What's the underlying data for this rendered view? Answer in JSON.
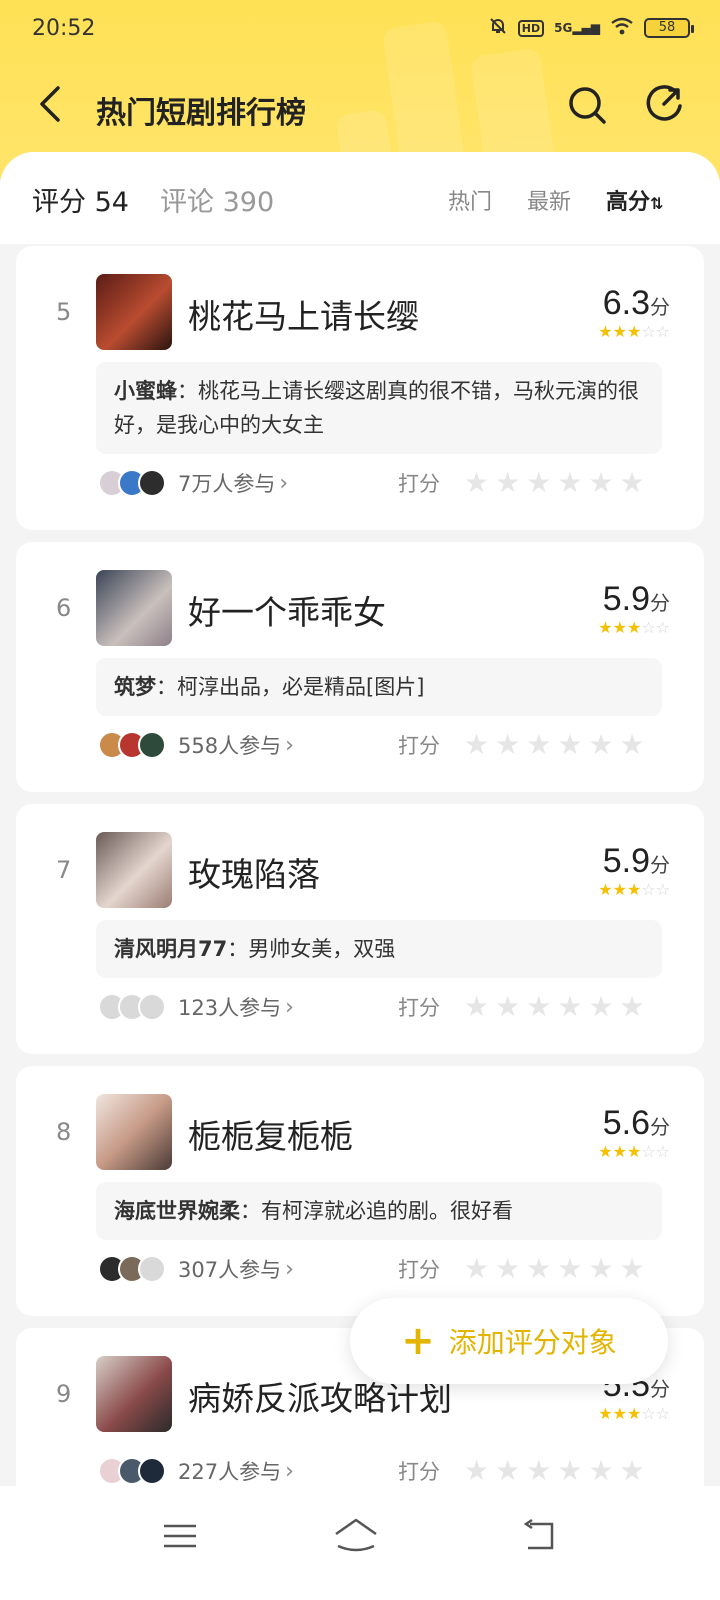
{
  "status_bar": {
    "time": "20:52",
    "battery": "58",
    "network": "5G",
    "hd": "HD"
  },
  "header": {
    "title": "热门短剧排行榜"
  },
  "summary": {
    "score_tab": "评分 54",
    "comment_tab": "评论 390"
  },
  "sort_options": [
    "热门",
    "最新",
    "高分"
  ],
  "sort_active_icon": "⇅",
  "rate_label": "打分",
  "items": [
    {
      "rank": "5",
      "title": "桃花马上请长缨",
      "score": "6.3",
      "unit": "分",
      "stars": 3,
      "user": "小蜜蜂",
      "comment": "：桃花马上请长缨这剧真的很不错，马秋元演的很好，是我心中的大女主",
      "participants": "7万人参与"
    },
    {
      "rank": "6",
      "title": "好一个乖乖女",
      "score": "5.9",
      "unit": "分",
      "stars": 3,
      "user": "筑梦",
      "comment": "：柯淳出品，必是精品[图片]",
      "participants": "558人参与"
    },
    {
      "rank": "7",
      "title": "玫瑰陷落",
      "score": "5.9",
      "unit": "分",
      "stars": 3,
      "user": "清风明月77",
      "comment": "：男帅女美，双强",
      "participants": "123人参与"
    },
    {
      "rank": "8",
      "title": "栀栀复栀栀",
      "score": "5.6",
      "unit": "分",
      "stars": 3,
      "user": "海底世界婉柔",
      "comment": "：有柯淳就必追的剧。很好看",
      "participants": "307人参与"
    },
    {
      "rank": "9",
      "title": "病娇反派攻略计划",
      "score": "5.5",
      "unit": "分",
      "stars": 3,
      "user": "",
      "comment": "",
      "participants": "227人参与"
    }
  ],
  "fab": {
    "label": "添加评分对象",
    "icon": "plus-icon"
  },
  "colors": {
    "accent": "#ffe155",
    "fab_text": "#e3b400",
    "star_on": "#f5c000"
  }
}
